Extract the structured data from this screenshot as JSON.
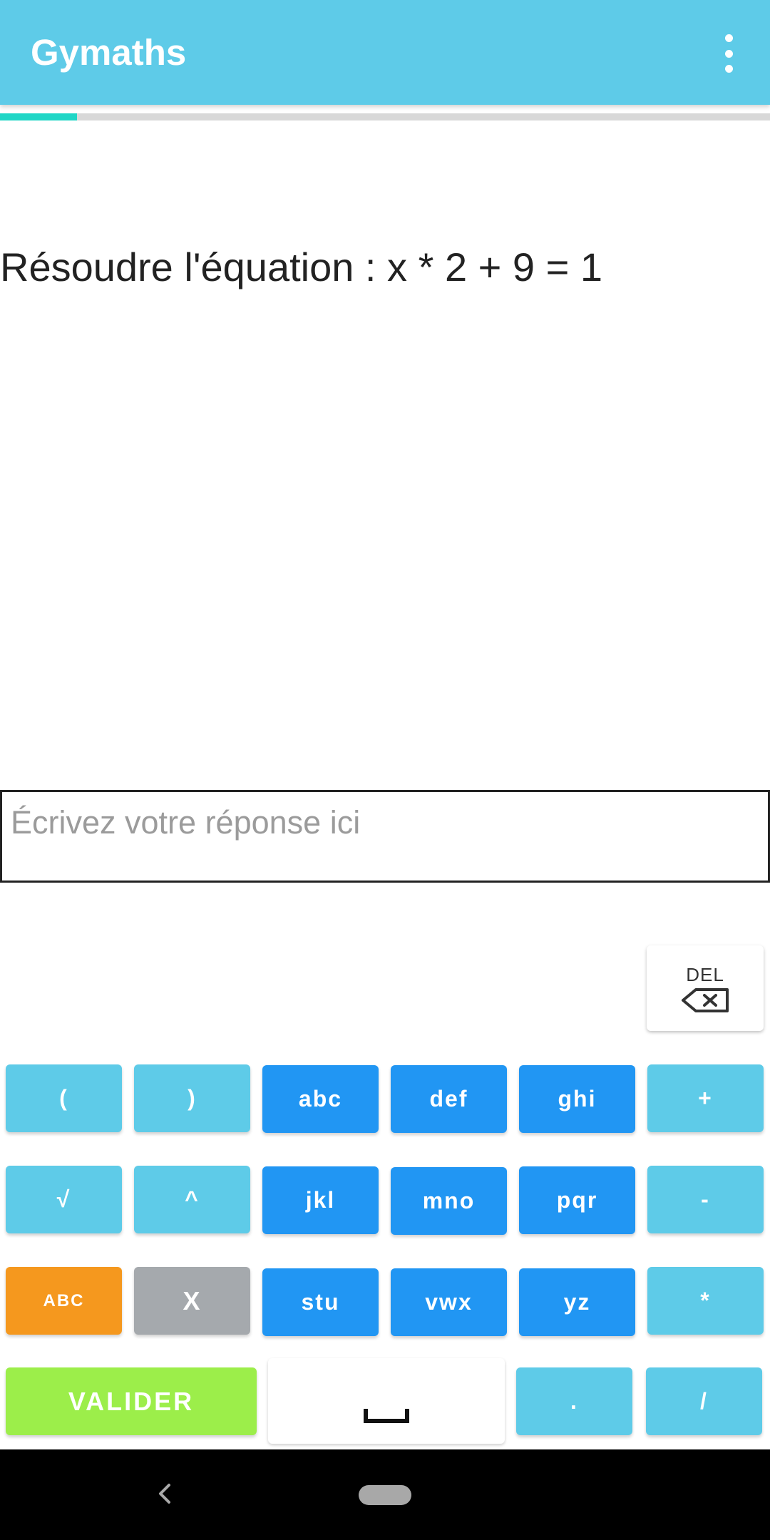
{
  "app_bar": {
    "title": "Gymaths",
    "overflow_icon": "more-vert-icon"
  },
  "progress": {
    "fraction": 0.1,
    "fill_color": "#1fd6c6",
    "track_color": "#d8d8d8"
  },
  "question": {
    "text": "Résoudre l'équation : x * 2 + 9 = 1"
  },
  "answer": {
    "value": "",
    "placeholder": "Écrivez votre réponse ici"
  },
  "delete_key": {
    "label": "DEL",
    "icon": "backspace-icon"
  },
  "keyboard": {
    "row1": [
      "(",
      ")",
      "abc",
      "def",
      "ghi",
      "+"
    ],
    "row2": [
      "√",
      "^",
      "jkl",
      "mno",
      "pqr",
      "-"
    ],
    "row3": [
      "ABC",
      "X",
      "stu",
      "vwx",
      "yz",
      "*"
    ],
    "row4": {
      "validate": "VALIDER",
      "space": "␣",
      "dot": ".",
      "slash": "/"
    }
  },
  "colors": {
    "app_bar": "#5ecbe8",
    "key_light": "#5ecbe8",
    "key_blue": "#2196f3",
    "key_orange": "#f5981e",
    "key_grey": "#a5a9ad",
    "key_green": "#9cee4a"
  },
  "system_nav": {
    "back_icon": "back-chevron-icon",
    "home_icon": "home-pill-icon"
  }
}
